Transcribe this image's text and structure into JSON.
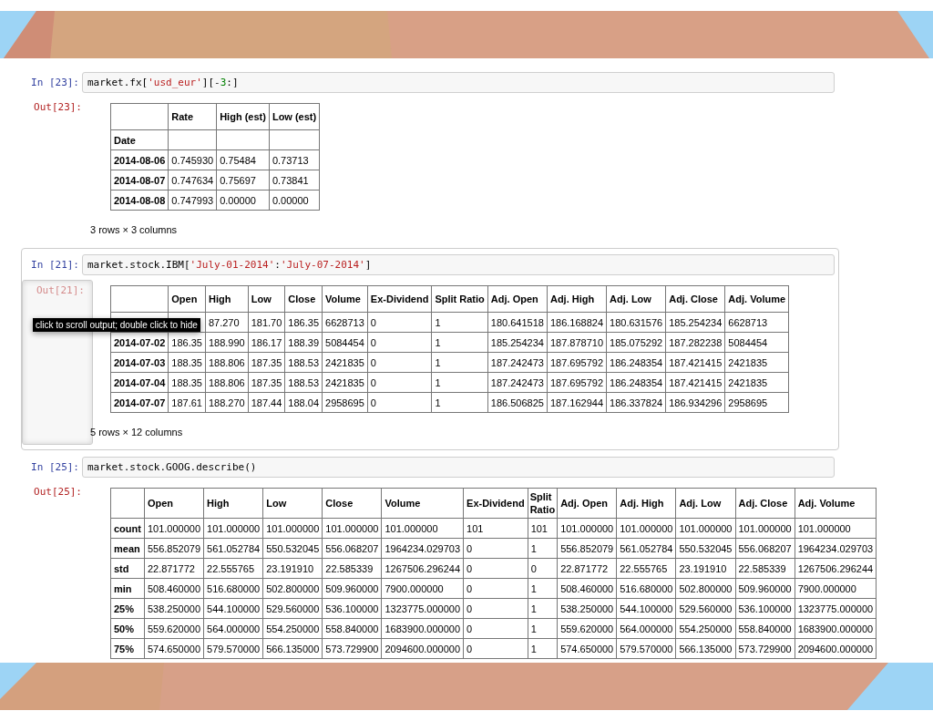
{
  "cells": [
    {
      "selected": false,
      "scrolled": false,
      "prompt_in": "In [23]:",
      "code": [
        {
          "text": "market.fx[",
          "kind": "plain"
        },
        {
          "text": "'usd_eur'",
          "kind": "string"
        },
        {
          "text": "][",
          "kind": "plain"
        },
        {
          "text": "-",
          "kind": "operator"
        },
        {
          "text": "3",
          "kind": "number"
        },
        {
          "text": ":]",
          "kind": "plain"
        }
      ],
      "prompt_out": "Out[23]:",
      "table": {
        "columns": [
          null,
          {
            "label": "Rate",
            "wrap": false
          },
          {
            "label": "High (est)",
            "wrap": false
          },
          {
            "label": "Low (est)",
            "wrap": false
          }
        ],
        "index_name": "Date",
        "rows": [
          [
            "2014-08-06",
            "0.745930",
            "0.75484",
            "0.73713"
          ],
          [
            "2014-08-07",
            "0.747634",
            "0.75697",
            "0.73841"
          ],
          [
            "2014-08-08",
            "0.747993",
            "0.00000",
            "0.00000"
          ]
        ]
      },
      "footer": "3 rows × 3 columns"
    },
    {
      "selected": true,
      "scrolled": true,
      "prompt_in": "In [21]:",
      "code": [
        {
          "text": "market.stock.IBM[",
          "kind": "plain"
        },
        {
          "text": "'July-01-2014'",
          "kind": "string"
        },
        {
          "text": ":",
          "kind": "plain"
        },
        {
          "text": "'July-07-2014'",
          "kind": "string"
        },
        {
          "text": "]",
          "kind": "plain"
        }
      ],
      "prompt_out": "Out[21]:",
      "tooltip": "click to scroll output; double click to hide",
      "table": {
        "columns": [
          null,
          {
            "label": "Open",
            "wrap": false
          },
          {
            "label": "High",
            "wrap": false
          },
          {
            "label": "Low",
            "wrap": false
          },
          {
            "label": "Close",
            "wrap": false
          },
          {
            "label": "Volume",
            "wrap": false
          },
          {
            "label": "Ex-Dividend",
            "wrap": false
          },
          {
            "label": "Split Ratio",
            "wrap": false
          },
          {
            "label": "Adj. Open",
            "wrap": false
          },
          {
            "label": "Adj. High",
            "wrap": false
          },
          {
            "label": "Adj. Low",
            "wrap": false
          },
          {
            "label": "Adj. Close",
            "wrap": false
          },
          {
            "label": "Adj. Volume",
            "wrap": false
          }
        ],
        "rows": [
          [
            null,
            null,
            "87.270",
            "181.70",
            "186.35",
            "6628713",
            "0",
            "1",
            "180.641518",
            "186.168824",
            "180.631576",
            "185.254234",
            "6628713"
          ],
          [
            "2014-07-02",
            "186.35",
            "188.990",
            "186.17",
            "188.39",
            "5084454",
            "0",
            "1",
            "185.254234",
            "187.878710",
            "185.075292",
            "187.282238",
            "5084454"
          ],
          [
            "2014-07-03",
            "188.35",
            "188.806",
            "187.35",
            "188.53",
            "2421835",
            "0",
            "1",
            "187.242473",
            "187.695792",
            "186.248354",
            "187.421415",
            "2421835"
          ],
          [
            "2014-07-04",
            "188.35",
            "188.806",
            "187.35",
            "188.53",
            "2421835",
            "0",
            "1",
            "187.242473",
            "187.695792",
            "186.248354",
            "187.421415",
            "2421835"
          ],
          [
            "2014-07-07",
            "187.61",
            "188.270",
            "187.44",
            "188.04",
            "2958695",
            "0",
            "1",
            "186.506825",
            "187.162944",
            "186.337824",
            "186.934296",
            "2958695"
          ]
        ]
      },
      "footer": "5 rows × 12 columns"
    },
    {
      "selected": false,
      "scrolled": false,
      "prompt_in": "In [25]:",
      "code": [
        {
          "text": "market.stock.GOOG.describe()",
          "kind": "plain"
        }
      ],
      "prompt_out": "Out[25]:",
      "table": {
        "columns": [
          null,
          {
            "label": "Open",
            "wrap": false
          },
          {
            "label": "High",
            "wrap": false
          },
          {
            "label": "Low",
            "wrap": false
          },
          {
            "label": "Close",
            "wrap": false
          },
          {
            "label": "Volume",
            "wrap": false
          },
          {
            "label": "Ex-Dividend",
            "wrap": false
          },
          {
            "label": "Split Ratio",
            "wrap": true
          },
          {
            "label": "Adj. Open",
            "wrap": false
          },
          {
            "label": "Adj. High",
            "wrap": false
          },
          {
            "label": "Adj. Low",
            "wrap": false
          },
          {
            "label": "Adj. Close",
            "wrap": false
          },
          {
            "label": "Adj. Volume",
            "wrap": false
          }
        ],
        "rows": [
          [
            "count",
            "101.000000",
            "101.000000",
            "101.000000",
            "101.000000",
            "101.000000",
            "101",
            "101",
            "101.000000",
            "101.000000",
            "101.000000",
            "101.000000",
            "101.000000"
          ],
          [
            "mean",
            "556.852079",
            "561.052784",
            "550.532045",
            "556.068207",
            "1964234.029703",
            "0",
            "1",
            "556.852079",
            "561.052784",
            "550.532045",
            "556.068207",
            "1964234.029703"
          ],
          [
            "std",
            "22.871772",
            "22.555765",
            "23.191910",
            "22.585339",
            "1267506.296244",
            "0",
            "0",
            "22.871772",
            "22.555765",
            "23.191910",
            "22.585339",
            "1267506.296244"
          ],
          [
            "min",
            "508.460000",
            "516.680000",
            "502.800000",
            "509.960000",
            "7900.000000",
            "0",
            "1",
            "508.460000",
            "516.680000",
            "502.800000",
            "509.960000",
            "7900.000000"
          ],
          [
            "25%",
            "538.250000",
            "544.100000",
            "529.560000",
            "536.100000",
            "1323775.000000",
            "0",
            "1",
            "538.250000",
            "544.100000",
            "529.560000",
            "536.100000",
            "1323775.000000"
          ],
          [
            "50%",
            "559.620000",
            "564.000000",
            "554.250000",
            "558.840000",
            "1683900.000000",
            "0",
            "1",
            "559.620000",
            "564.000000",
            "554.250000",
            "558.840000",
            "1683900.000000"
          ],
          [
            "75%",
            "574.650000",
            "579.570000",
            "566.135000",
            "573.729900",
            "2094600.000000",
            "0",
            "1",
            "574.650000",
            "579.570000",
            "566.135000",
            "573.729900",
            "2094600.000000"
          ]
        ]
      }
    }
  ]
}
